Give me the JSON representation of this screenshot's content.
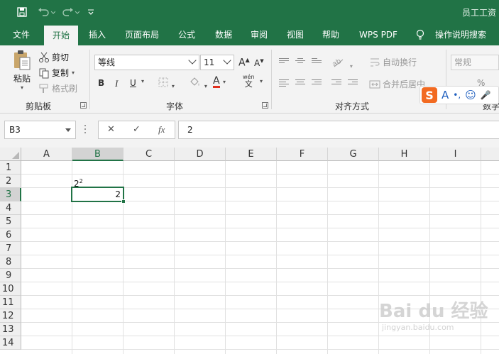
{
  "titlebar": {
    "title": "员工工资",
    "bg_color": "#217346"
  },
  "tabs": [
    {
      "label": "文件"
    },
    {
      "label": "开始",
      "active": true
    },
    {
      "label": "插入"
    },
    {
      "label": "页面布局"
    },
    {
      "label": "公式"
    },
    {
      "label": "数据"
    },
    {
      "label": "审阅"
    },
    {
      "label": "视图"
    },
    {
      "label": "帮助"
    },
    {
      "label": "WPS PDF"
    },
    {
      "label": "操作说明搜索"
    }
  ],
  "ribbon": {
    "clipboard": {
      "paste_label": "粘贴",
      "cut_label": "剪切",
      "copy_label": "复制",
      "format_painter_label": "格式刷",
      "group_label": "剪贴板"
    },
    "font": {
      "font_name": "等线",
      "font_size": "11",
      "bold": "B",
      "italic": "I",
      "underline": "U",
      "font_color_glyph": "A",
      "grow_glyph": "A",
      "shrink_glyph": "A",
      "phonetic_top": "wén",
      "phonetic_bottom": "文",
      "group_label": "字体"
    },
    "alignment": {
      "wrap_label": "自动换行",
      "merge_label": "合并后居中",
      "group_label": "对齐方式"
    },
    "number": {
      "format_value": "常规",
      "percent_glyph": "%",
      "group_label": "数字"
    }
  },
  "ime": {
    "logo": "S",
    "items": [
      "A",
      "•,",
      "☺",
      "🎤"
    ]
  },
  "formula_bar": {
    "name_box": "B3",
    "cancel_glyph": "✕",
    "enter_glyph": "✓",
    "fx_glyph": "fx",
    "formula_value": "2"
  },
  "grid": {
    "columns": [
      "A",
      "B",
      "C",
      "D",
      "E",
      "F",
      "G",
      "H",
      "I"
    ],
    "rows": [
      "1",
      "2",
      "3",
      "4",
      "5",
      "6",
      "7",
      "8",
      "9",
      "10",
      "11",
      "12",
      "13",
      "14"
    ],
    "selected_column": "B",
    "selected_row": "3",
    "cells": {
      "B2_base": "2",
      "B2_sup": "2",
      "B3": "2"
    }
  },
  "watermark": {
    "text": "Bai du 经验",
    "url_text": "jingyan.baidu.com"
  }
}
